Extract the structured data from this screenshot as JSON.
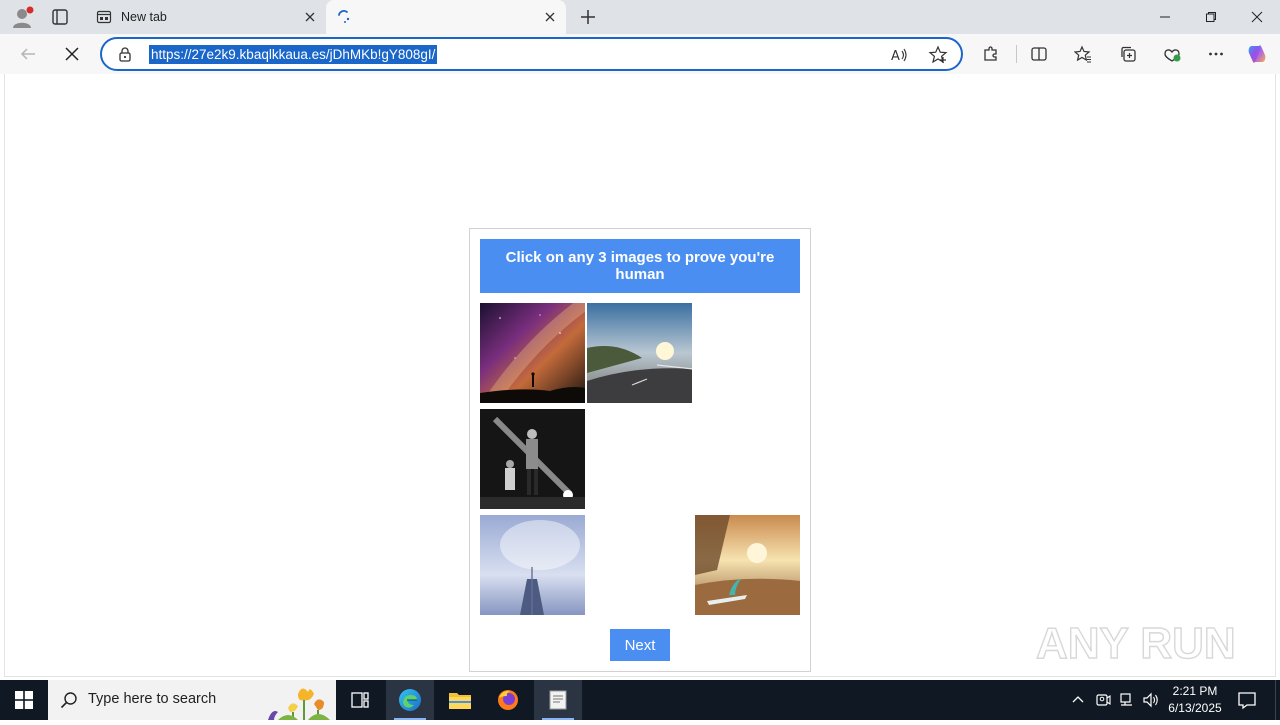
{
  "browser": {
    "tabs": [
      {
        "title": "New tab",
        "active": false
      },
      {
        "title": "",
        "active": true,
        "loading": true
      }
    ],
    "address_bar": {
      "url": "https://27e2k9.kbaqlkkaua.es/jDhMKb!gY808gI/"
    }
  },
  "captcha": {
    "instruction": "Click on any 3 images to prove you're human",
    "tiles": [
      {
        "name": "milky-way-silhouette"
      },
      {
        "name": "coastal-road-sunset"
      },
      {
        "name": "band-performing-bw"
      },
      {
        "name": "skyscraper-from-below"
      },
      {
        "name": "beach-surfboard-sunset"
      }
    ],
    "next_label": "Next"
  },
  "watermark": {
    "text": "ANY RUN"
  },
  "taskbar": {
    "search_placeholder": "Type here to search",
    "clock_time": "2:21 PM",
    "clock_date": "6/13/2025"
  },
  "colors": {
    "accent": "#4a8ef2",
    "omnibox_border": "#1a66c9",
    "taskbar_bg": "#101823"
  }
}
